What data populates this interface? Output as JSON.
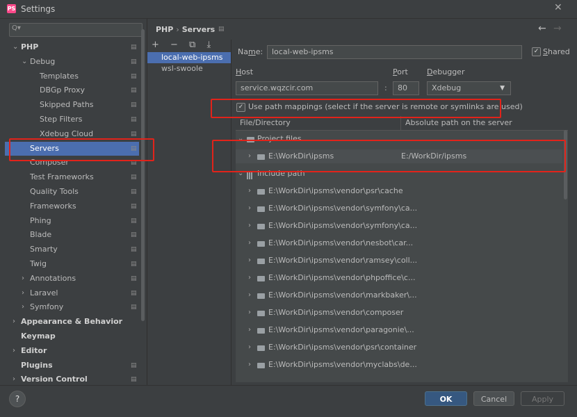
{
  "window": {
    "title": "Settings",
    "app_icon": "PS"
  },
  "search": {
    "placeholder": ""
  },
  "tree": [
    {
      "label": "PHP",
      "level": 0,
      "expanded": true,
      "bold": true,
      "cfg": true
    },
    {
      "label": "Debug",
      "level": 1,
      "expanded": true,
      "cfg": true
    },
    {
      "label": "Templates",
      "level": 2,
      "cfg": true
    },
    {
      "label": "DBGp Proxy",
      "level": 2,
      "cfg": true
    },
    {
      "label": "Skipped Paths",
      "level": 2,
      "cfg": true
    },
    {
      "label": "Step Filters",
      "level": 2,
      "cfg": true
    },
    {
      "label": "Xdebug Cloud",
      "level": 2,
      "cfg": true
    },
    {
      "label": "Servers",
      "level": 1,
      "selected": true,
      "cfg": true
    },
    {
      "label": "Composer",
      "level": 1,
      "cfg": true
    },
    {
      "label": "Test Frameworks",
      "level": 1,
      "cfg": true
    },
    {
      "label": "Quality Tools",
      "level": 1,
      "cfg": true
    },
    {
      "label": "Frameworks",
      "level": 1,
      "cfg": true
    },
    {
      "label": "Phing",
      "level": 1,
      "cfg": true
    },
    {
      "label": "Blade",
      "level": 1,
      "cfg": true
    },
    {
      "label": "Smarty",
      "level": 1,
      "cfg": true
    },
    {
      "label": "Twig",
      "level": 1,
      "cfg": true
    },
    {
      "label": "Annotations",
      "level": 1,
      "collapsed": true,
      "cfg": true
    },
    {
      "label": "Laravel",
      "level": 1,
      "collapsed": true,
      "cfg": true
    },
    {
      "label": "Symfony",
      "level": 1,
      "collapsed": true,
      "cfg": true
    },
    {
      "label": "Appearance & Behavior",
      "level": 0,
      "collapsed": true,
      "bold": true
    },
    {
      "label": "Keymap",
      "level": 0,
      "bold": true
    },
    {
      "label": "Editor",
      "level": 0,
      "collapsed": true,
      "bold": true
    },
    {
      "label": "Plugins",
      "level": 0,
      "bold": true,
      "cfg": true
    },
    {
      "label": "Version Control",
      "level": 0,
      "collapsed": true,
      "bold": true,
      "cfg": true
    }
  ],
  "breadcrumb": {
    "root": "PHP",
    "separator": "›",
    "current": "Servers"
  },
  "nav": {
    "back": "←",
    "forward": "→"
  },
  "servers_toolbar": "+ − ⧉ ⤓",
  "servers": [
    "local-web-ipsms",
    "wsl-swoole"
  ],
  "form": {
    "name_label_pre": "Na",
    "name_label_u": "m",
    "name_label_post": "e:",
    "name_value": "local-web-ipsms",
    "shared_label_u": "S",
    "shared_label": "hared",
    "shared_checked": "✓",
    "host_label_u": "H",
    "host_label": "ost",
    "port_label_u": "P",
    "port_label": "ort",
    "debugger_label_u": "D",
    "debugger_label": "ebugger",
    "host_value": "service.wqzcir.com",
    "colon": ":",
    "port_value": "80",
    "debugger_value": "Xdebug",
    "path_mappings_checked": "✓",
    "path_mappings_label": "Use path mappings (select if the server is remote or symlinks are used)"
  },
  "grid": {
    "col_file": "File/Directory",
    "col_abs": "Absolute path on the server",
    "project_files": "Project files",
    "project_row": {
      "path": "E:\\WorkDir\\ipsms",
      "server_path": "E:/WorkDir/ipsms"
    },
    "include_path": "Include path",
    "include_rows": [
      "E:\\WorkDir\\ipsms\\vendor\\psr\\cache",
      "E:\\WorkDir\\ipsms\\vendor\\symfony\\ca...",
      "E:\\WorkDir\\ipsms\\vendor\\symfony\\ca...",
      "E:\\WorkDir\\ipsms\\vendor\\nesbot\\car...",
      "E:\\WorkDir\\ipsms\\vendor\\ramsey\\coll...",
      "E:\\WorkDir\\ipsms\\vendor\\phpoffice\\c...",
      "E:\\WorkDir\\ipsms\\vendor\\markbaker\\...",
      "E:\\WorkDir\\ipsms\\vendor\\composer",
      "E:\\WorkDir\\ipsms\\vendor\\paragonie\\...",
      "E:\\WorkDir\\ipsms\\vendor\\psr\\container",
      "E:\\WorkDir\\ipsms\\vendor\\myclabs\\de..."
    ]
  },
  "buttons": {
    "help": "?",
    "ok": "OK",
    "cancel": "Cancel",
    "apply": "Apply"
  },
  "icons": {
    "close": "✕",
    "search": "Q▾",
    "cfg": "▤",
    "expand": "⌄",
    "collapse": "›",
    "dropdown": "▼"
  },
  "colors": {
    "selection": "#4b6eaf",
    "highlight_box": "#e2231a",
    "ok_button": "#365880"
  }
}
